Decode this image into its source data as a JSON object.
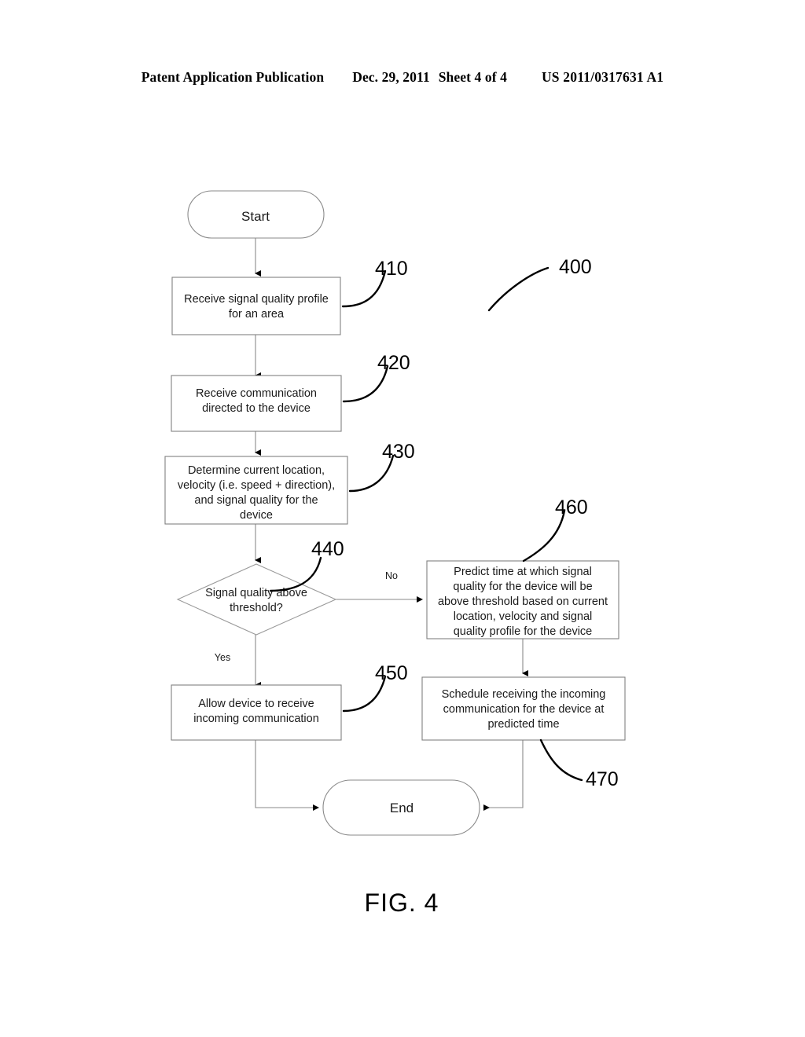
{
  "header": {
    "publication": "Patent Application Publication",
    "date": "Dec. 29, 2011",
    "sheet": "Sheet 4 of 4",
    "number": "US 2011/0317631 A1"
  },
  "figure": {
    "caption": "FIG. 4",
    "diagram_ref": "400"
  },
  "nodes": {
    "start": {
      "label": "Start"
    },
    "end": {
      "label": "End"
    },
    "n410": {
      "ref": "410",
      "lines": [
        "Receive signal quality profile",
        "for an area"
      ]
    },
    "n420": {
      "ref": "420",
      "lines": [
        "Receive communication",
        "directed to the device"
      ]
    },
    "n430": {
      "ref": "430",
      "lines": [
        "Determine current location,",
        "velocity (i.e. speed + direction),",
        "and signal quality for the",
        "device"
      ]
    },
    "n440": {
      "ref": "440",
      "lines": [
        "Signal quality above",
        "threshold?"
      ]
    },
    "n450": {
      "ref": "450",
      "lines": [
        "Allow device to receive",
        "incoming communication"
      ]
    },
    "n460": {
      "ref": "460",
      "lines": [
        "Predict time at which signal",
        "quality for the device will be",
        "above threshold based on current",
        "location, velocity and signal",
        "quality profile for the device"
      ]
    },
    "n470": {
      "ref": "470",
      "lines": [
        "Schedule receiving the incoming",
        "communication for the device at",
        "predicted time"
      ]
    }
  },
  "branches": {
    "yes": "Yes",
    "no": "No"
  },
  "colors": {
    "ink": "#000000",
    "shape_stroke": "#8a8a8a",
    "text": "#1a1a1a",
    "background": "#ffffff"
  }
}
